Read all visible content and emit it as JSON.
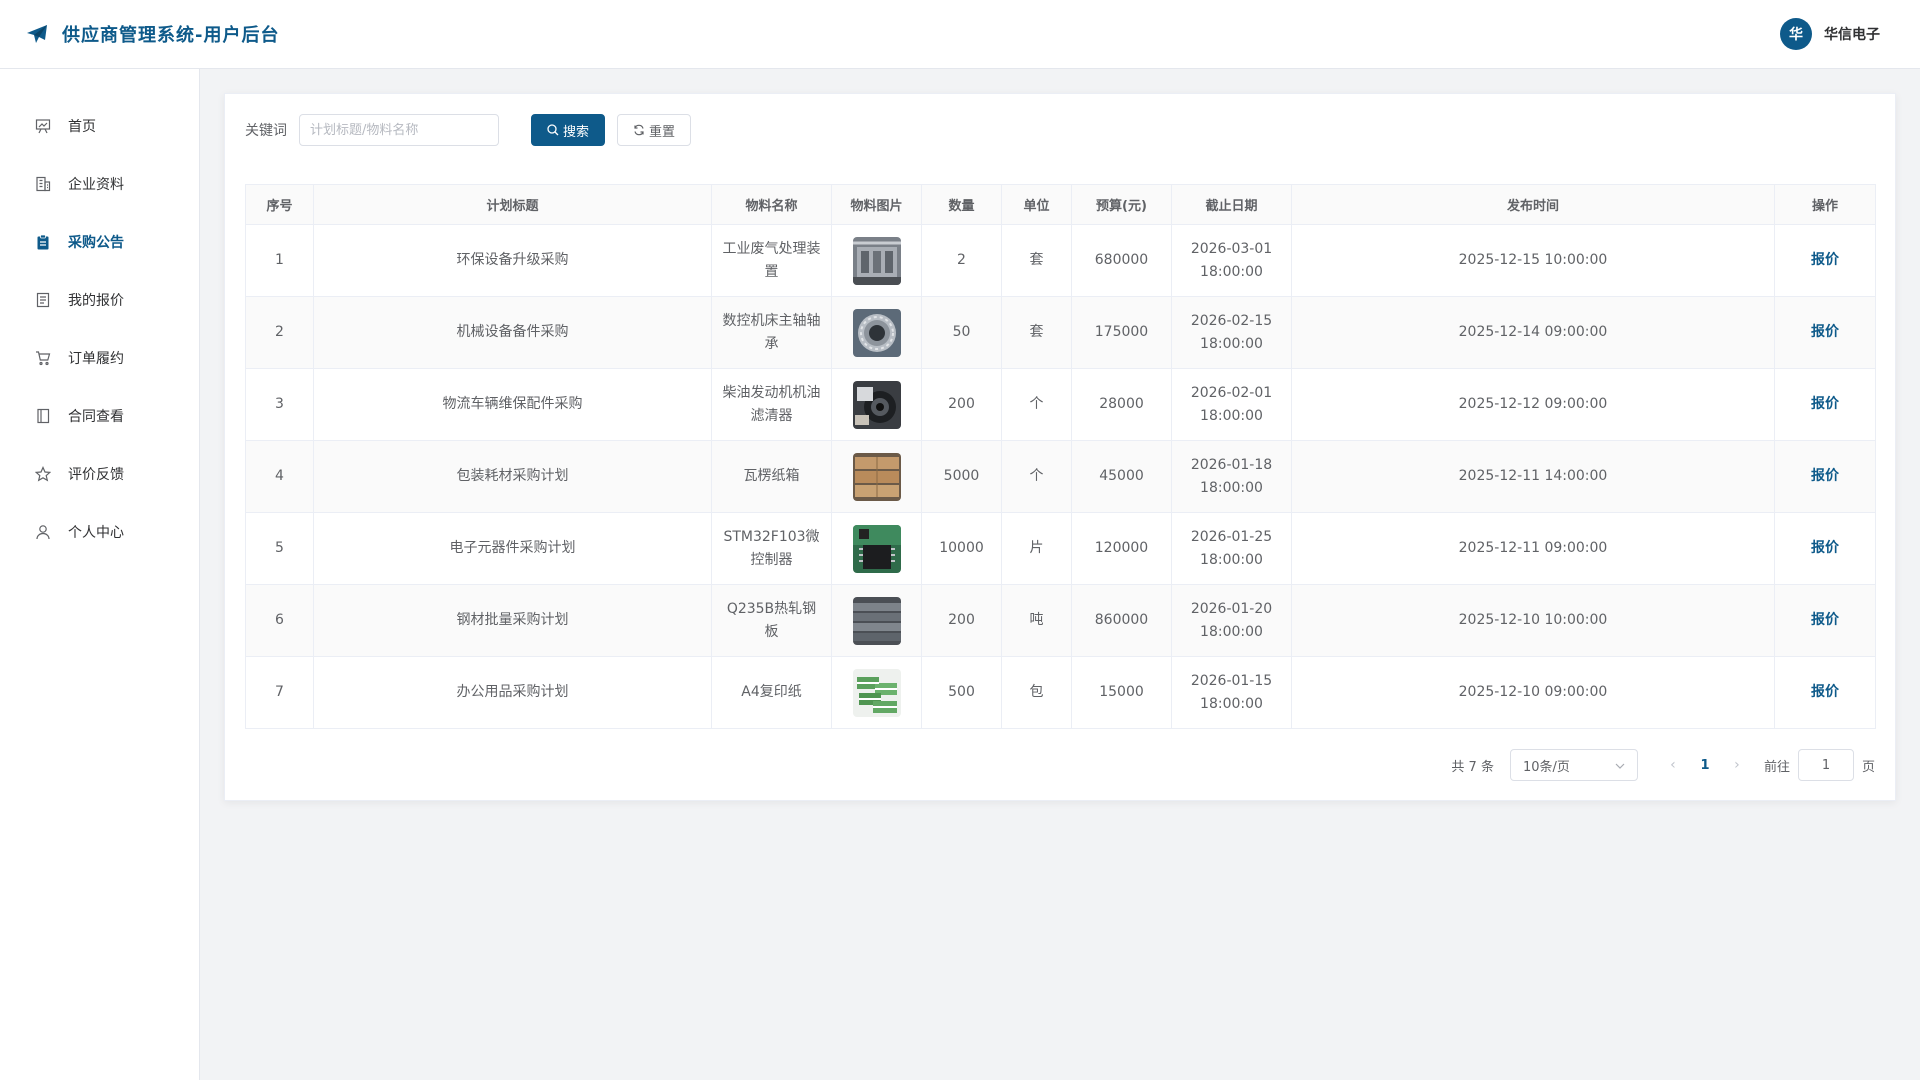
{
  "header": {
    "title": "供应商管理系统-用户后台",
    "avatar_char": "华",
    "user_name": "华信电子"
  },
  "sidebar": {
    "items": [
      {
        "label": "首页",
        "icon": "presentation-icon",
        "active": false
      },
      {
        "label": "企业资料",
        "icon": "building-icon",
        "active": false
      },
      {
        "label": "采购公告",
        "icon": "clipboard-icon",
        "active": true
      },
      {
        "label": "我的报价",
        "icon": "document-icon",
        "active": false
      },
      {
        "label": "订单履约",
        "icon": "cart-icon",
        "active": false
      },
      {
        "label": "合同查看",
        "icon": "notebook-icon",
        "active": false
      },
      {
        "label": "评价反馈",
        "icon": "star-icon",
        "active": false
      },
      {
        "label": "个人中心",
        "icon": "user-icon",
        "active": false
      }
    ]
  },
  "search": {
    "label": "关键词",
    "placeholder": "计划标题/物料名称",
    "value": "",
    "search_button": "搜索",
    "reset_button": "重置"
  },
  "table": {
    "columns": [
      "序号",
      "计划标题",
      "物料名称",
      "物料图片",
      "数量",
      "单位",
      "预算(元)",
      "截止日期",
      "发布时间",
      "操作"
    ],
    "rows": [
      {
        "no": "1",
        "title": "环保设备升级采购",
        "material": "工业废气处理装置",
        "image": "air-treatment-equipment",
        "qty": "2",
        "unit": "套",
        "budget": "680000",
        "deadline_date": "2026-03-01",
        "deadline_time": "18:00:00",
        "published": "2025-12-15 10:00:00",
        "action": "报价"
      },
      {
        "no": "2",
        "title": "机械设备备件采购",
        "material": "数控机床主轴轴承",
        "image": "bearing",
        "qty": "50",
        "unit": "套",
        "budget": "175000",
        "deadline_date": "2026-02-15",
        "deadline_time": "18:00:00",
        "published": "2025-12-14 09:00:00",
        "action": "报价"
      },
      {
        "no": "3",
        "title": "物流车辆维保配件采购",
        "material": "柴油发动机机油滤清器",
        "image": "oil-filter",
        "qty": "200",
        "unit": "个",
        "budget": "28000",
        "deadline_date": "2026-02-01",
        "deadline_time": "18:00:00",
        "published": "2025-12-12 09:00:00",
        "action": "报价"
      },
      {
        "no": "4",
        "title": "包装耗材采购计划",
        "material": "瓦楞纸箱",
        "image": "cardboard-boxes",
        "qty": "5000",
        "unit": "个",
        "budget": "45000",
        "deadline_date": "2026-01-18",
        "deadline_time": "18:00:00",
        "published": "2025-12-11 14:00:00",
        "action": "报价"
      },
      {
        "no": "5",
        "title": "电子元器件采购计划",
        "material": "STM32F103微控制器",
        "image": "microcontroller",
        "qty": "10000",
        "unit": "片",
        "budget": "120000",
        "deadline_date": "2026-01-25",
        "deadline_time": "18:00:00",
        "published": "2025-12-11 09:00:00",
        "action": "报价"
      },
      {
        "no": "6",
        "title": "钢材批量采购计划",
        "material": "Q235B热轧钢板",
        "image": "steel-plates",
        "qty": "200",
        "unit": "吨",
        "budget": "860000",
        "deadline_date": "2026-01-20",
        "deadline_time": "18:00:00",
        "published": "2025-12-10 10:00:00",
        "action": "报价"
      },
      {
        "no": "7",
        "title": "办公用品采购计划",
        "material": "A4复印纸",
        "image": "copy-paper",
        "qty": "500",
        "unit": "包",
        "budget": "15000",
        "deadline_date": "2026-01-15",
        "deadline_time": "18:00:00",
        "published": "2025-12-10 09:00:00",
        "action": "报价"
      }
    ]
  },
  "pagination": {
    "total_text": "共 7 条",
    "page_size": "10条/页",
    "current_page": "1",
    "goto_label": "前往",
    "goto_value": "1",
    "goto_suffix": "页"
  },
  "colors": {
    "primary": "#0e5a8a",
    "background": "#f2f3f5"
  }
}
